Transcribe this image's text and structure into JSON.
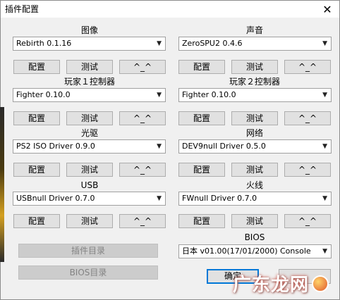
{
  "window": {
    "title": "插件配置",
    "close_glyph": "✕"
  },
  "sections": [
    {
      "id": "graphics",
      "label": "图像",
      "selected": "Rebirth 0.1.16",
      "buttons": [
        "配置",
        "测试",
        "^_^"
      ]
    },
    {
      "id": "sound",
      "label": "声音",
      "selected": "ZeroSPU2  0.4.6",
      "buttons": [
        "配置",
        "测试",
        "^_^"
      ]
    },
    {
      "id": "pad1",
      "label": "玩家１控制器",
      "selected": "Fighter 0.10.0",
      "buttons": [
        "配置",
        "测试",
        "^_^"
      ]
    },
    {
      "id": "pad2",
      "label": "玩家２控制器",
      "selected": "Fighter 0.10.0",
      "buttons": [
        "配置",
        "测试",
        "^_^"
      ]
    },
    {
      "id": "cdvd",
      "label": "光驱",
      "selected": "PS2 ISO Driver 0.9.0",
      "buttons": [
        "配置",
        "测试",
        "^_^"
      ]
    },
    {
      "id": "dev9",
      "label": "网络",
      "selected": "DEV9null Driver 0.5.0",
      "buttons": [
        "配置",
        "测试",
        "^_^"
      ]
    },
    {
      "id": "usb",
      "label": "USB",
      "selected": "USBnull Driver 0.7.0",
      "buttons": [
        "配置",
        "测试",
        "^_^"
      ]
    },
    {
      "id": "fw",
      "label": "火线",
      "selected": "FWnull Driver 0.7.0",
      "buttons": [
        "配置",
        "测试",
        "^_^"
      ]
    }
  ],
  "plugin_dir_button": "插件目录",
  "bios_dir_button": "BIOS目录",
  "bios": {
    "label": "BIOS",
    "selected": "日本   v01.00(17/01/2000) Console"
  },
  "ok_button": "确定",
  "watermark": "广东龙网"
}
